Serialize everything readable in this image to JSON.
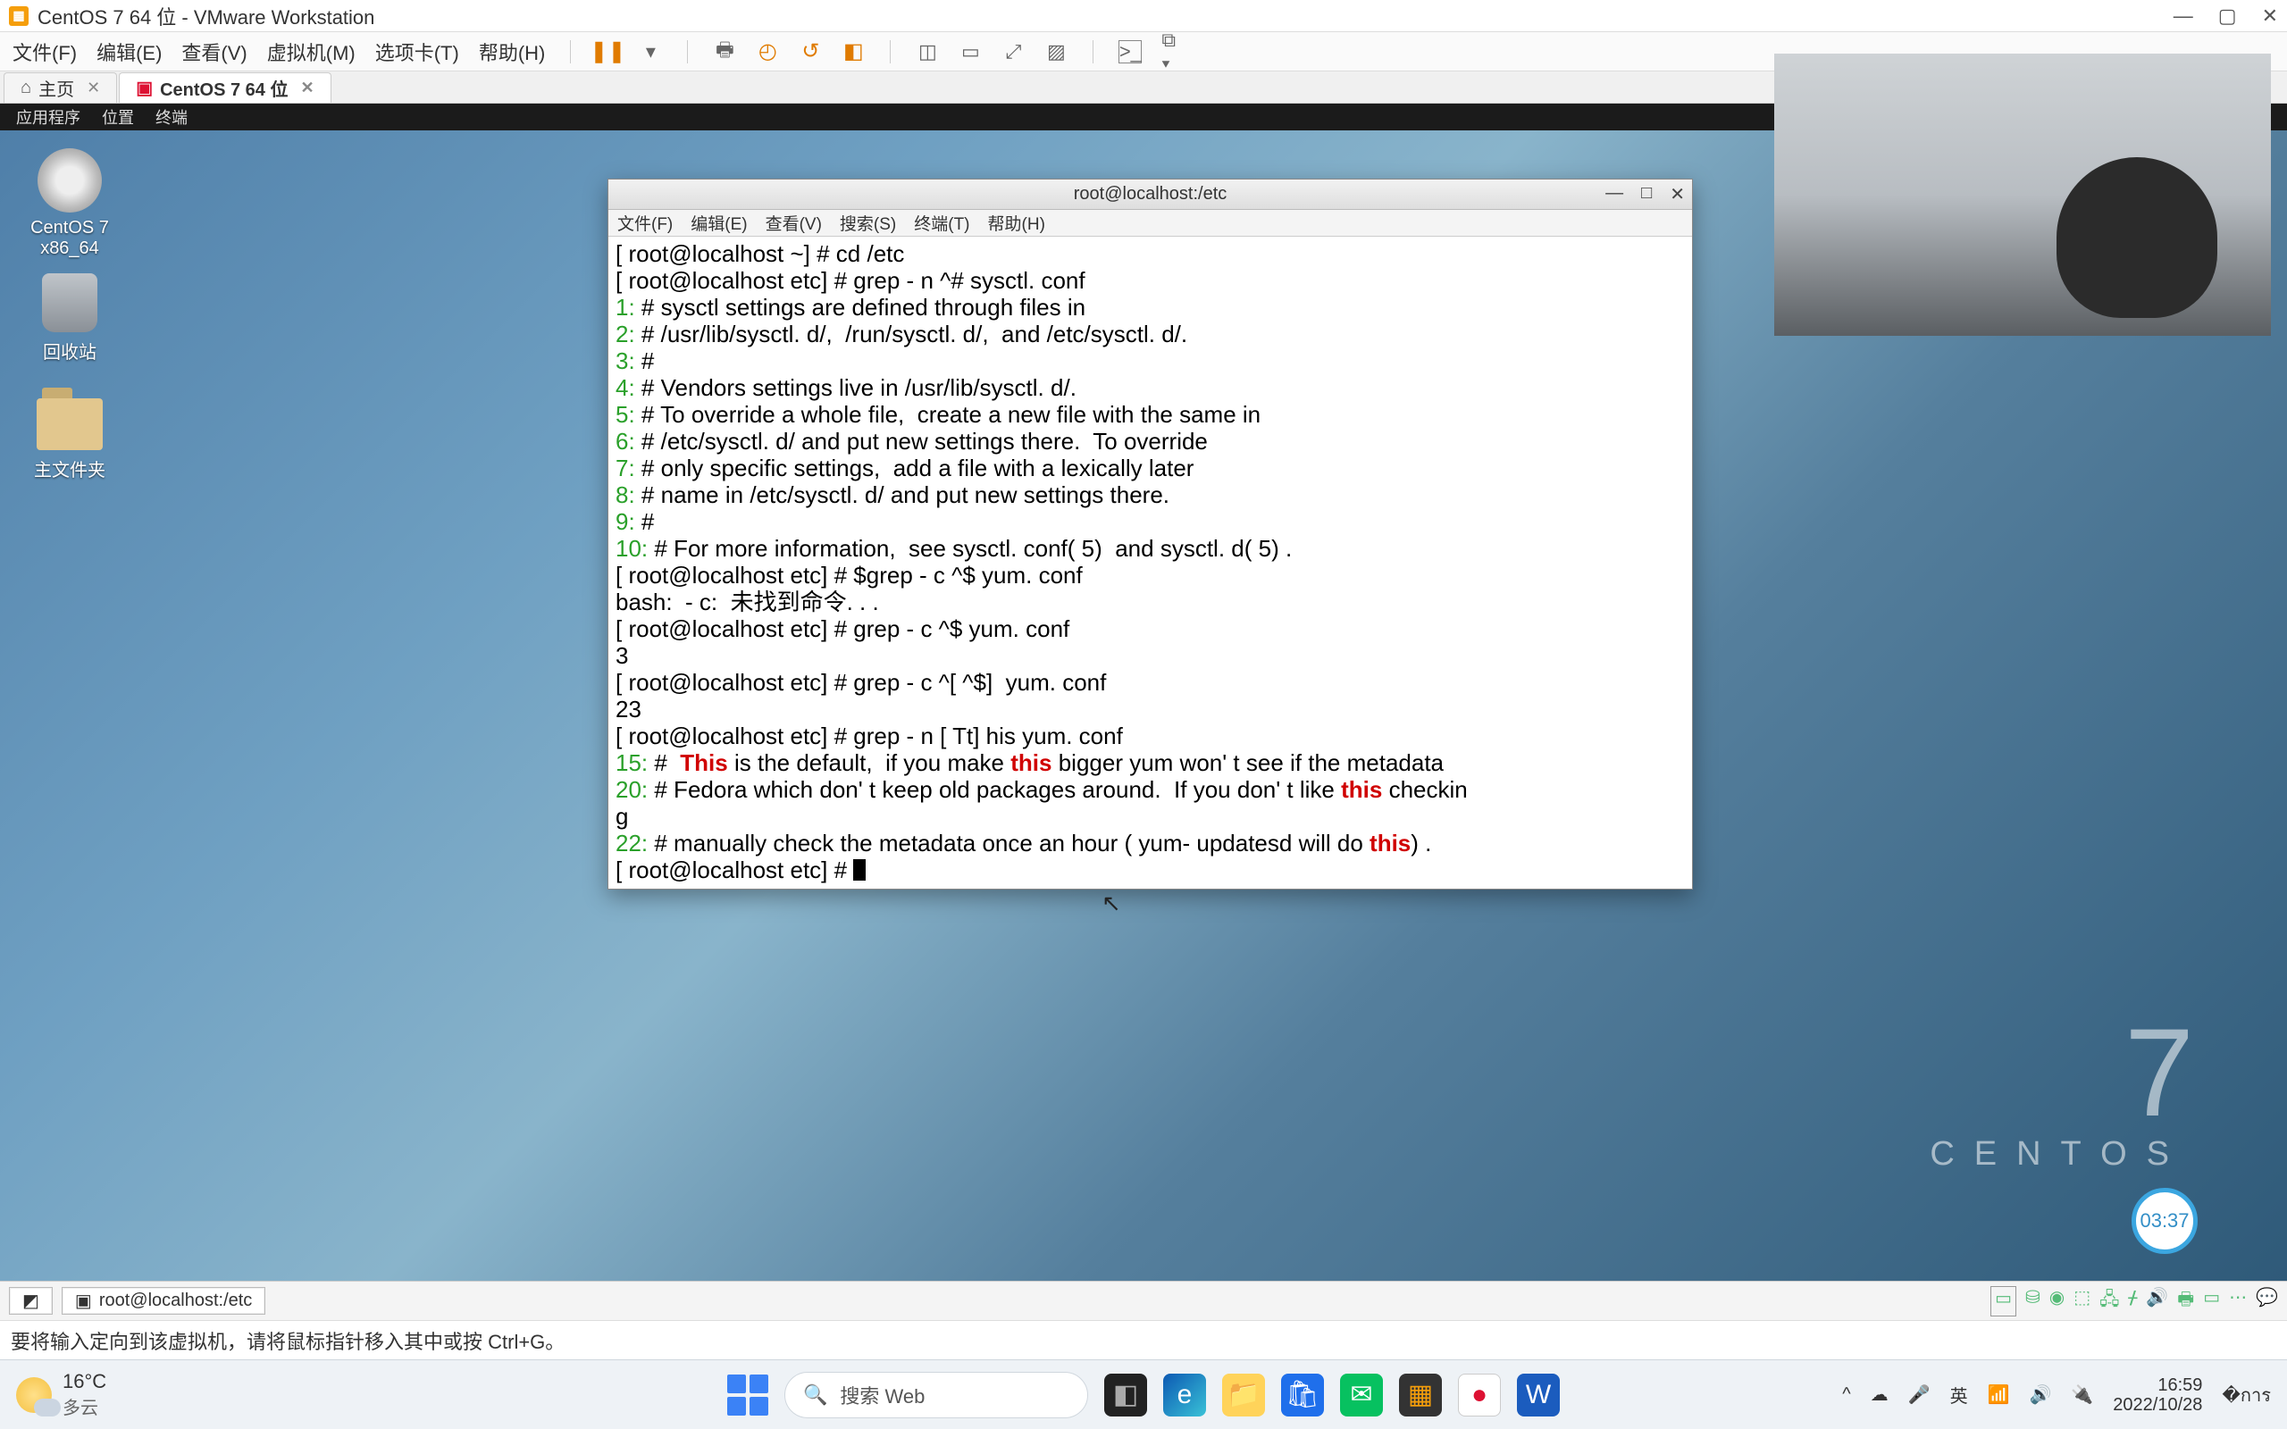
{
  "vmware": {
    "title": "CentOS 7 64 位 - VMware Workstation",
    "menus": {
      "file": "文件(F)",
      "edit": "编辑(E)",
      "view": "查看(V)",
      "vm": "虚拟机(M)",
      "tabs_m": "选项卡(T)",
      "help": "帮助(H)"
    },
    "tabs": {
      "home": "主页",
      "active": "CentOS 7 64 位"
    }
  },
  "gnome": {
    "apps": "应用程序",
    "places": "位置",
    "terminal": "终端"
  },
  "desk": {
    "disc": "CentOS 7 x86_64",
    "trash": "回收站",
    "home": "主文件夹"
  },
  "term": {
    "title": "root@localhost:/etc",
    "menus": {
      "file": "文件(F)",
      "edit": "编辑(E)",
      "view": "查看(V)",
      "search": "搜索(S)",
      "terminal": "终端(T)",
      "help": "帮助(H)"
    },
    "lines": {
      "p1": "[ root@localhost ~] # cd /etc",
      "p2": "[ root@localhost etc] # grep - n ^# sysctl. conf",
      "l1": "1: ",
      "t1": "# sysctl settings are defined through files in",
      "l2": "2: ",
      "t2": "# /usr/lib/sysctl. d/,  /run/sysctl. d/,  and /etc/sysctl. d/.",
      "l3": "3: ",
      "t3": "#",
      "l4": "4: ",
      "t4": "# Vendors settings live in /usr/lib/sysctl. d/.",
      "l5": "5: ",
      "t5": "# To override a whole file,  create a new file with the same in",
      "l6": "6: ",
      "t6": "# /etc/sysctl. d/ and put new settings there.  To override",
      "l7": "7: ",
      "t7": "# only specific settings,  add a file with a lexically later",
      "l8": "8: ",
      "t8": "# name in /etc/sysctl. d/ and put new settings there.",
      "l9": "9: ",
      "t9": "#",
      "l10": "10: ",
      "t10": "# For more information,  see sysctl. conf( 5)  and sysctl. d( 5) .",
      "p3": "[ root@localhost etc] # $grep - c ^$ yum. conf",
      "e1": "bash:  - c:  未找到命令. . .",
      "p4": "[ root@localhost etc] # grep - c ^$ yum. conf",
      "r4": "3",
      "p5": "[ root@localhost etc] # grep - c ^[ ^$]  yum. conf",
      "r5": "23",
      "p6": "[ root@localhost etc] # grep - n [ Tt] his yum. conf",
      "l15": "15: ",
      "t15a": "#  ",
      "t15b": "This",
      "t15c": " is the default,  if you make ",
      "t15d": "this",
      "t15e": " bigger yum won' t see if the metadata",
      "l20": "20: ",
      "t20a": "# Fedora which don' t keep old packages around.  If you don' t like ",
      "t20b": "this",
      "t20c": " checkin",
      "t20g": "g",
      "l22": "22: ",
      "t22a": "# manually check the metadata once an hour ( yum- updatesd will do ",
      "t22b": "this",
      "t22c": ") .",
      "p7": "[ root@localhost etc] # "
    }
  },
  "centos": {
    "seven": "7",
    "word": "CENTOS",
    "badge": "03:37"
  },
  "statusstrip": {
    "task": "root@localhost:/etc"
  },
  "hint": "要将输入定向到该虚拟机，请将鼠标指针移入其中或按 Ctrl+G。",
  "win": {
    "weather_temp": "16°C",
    "weather_txt": "多云",
    "search_placeholder": "搜索 Web",
    "ime": "英",
    "time": "16:59",
    "date": "2022/10/28"
  }
}
